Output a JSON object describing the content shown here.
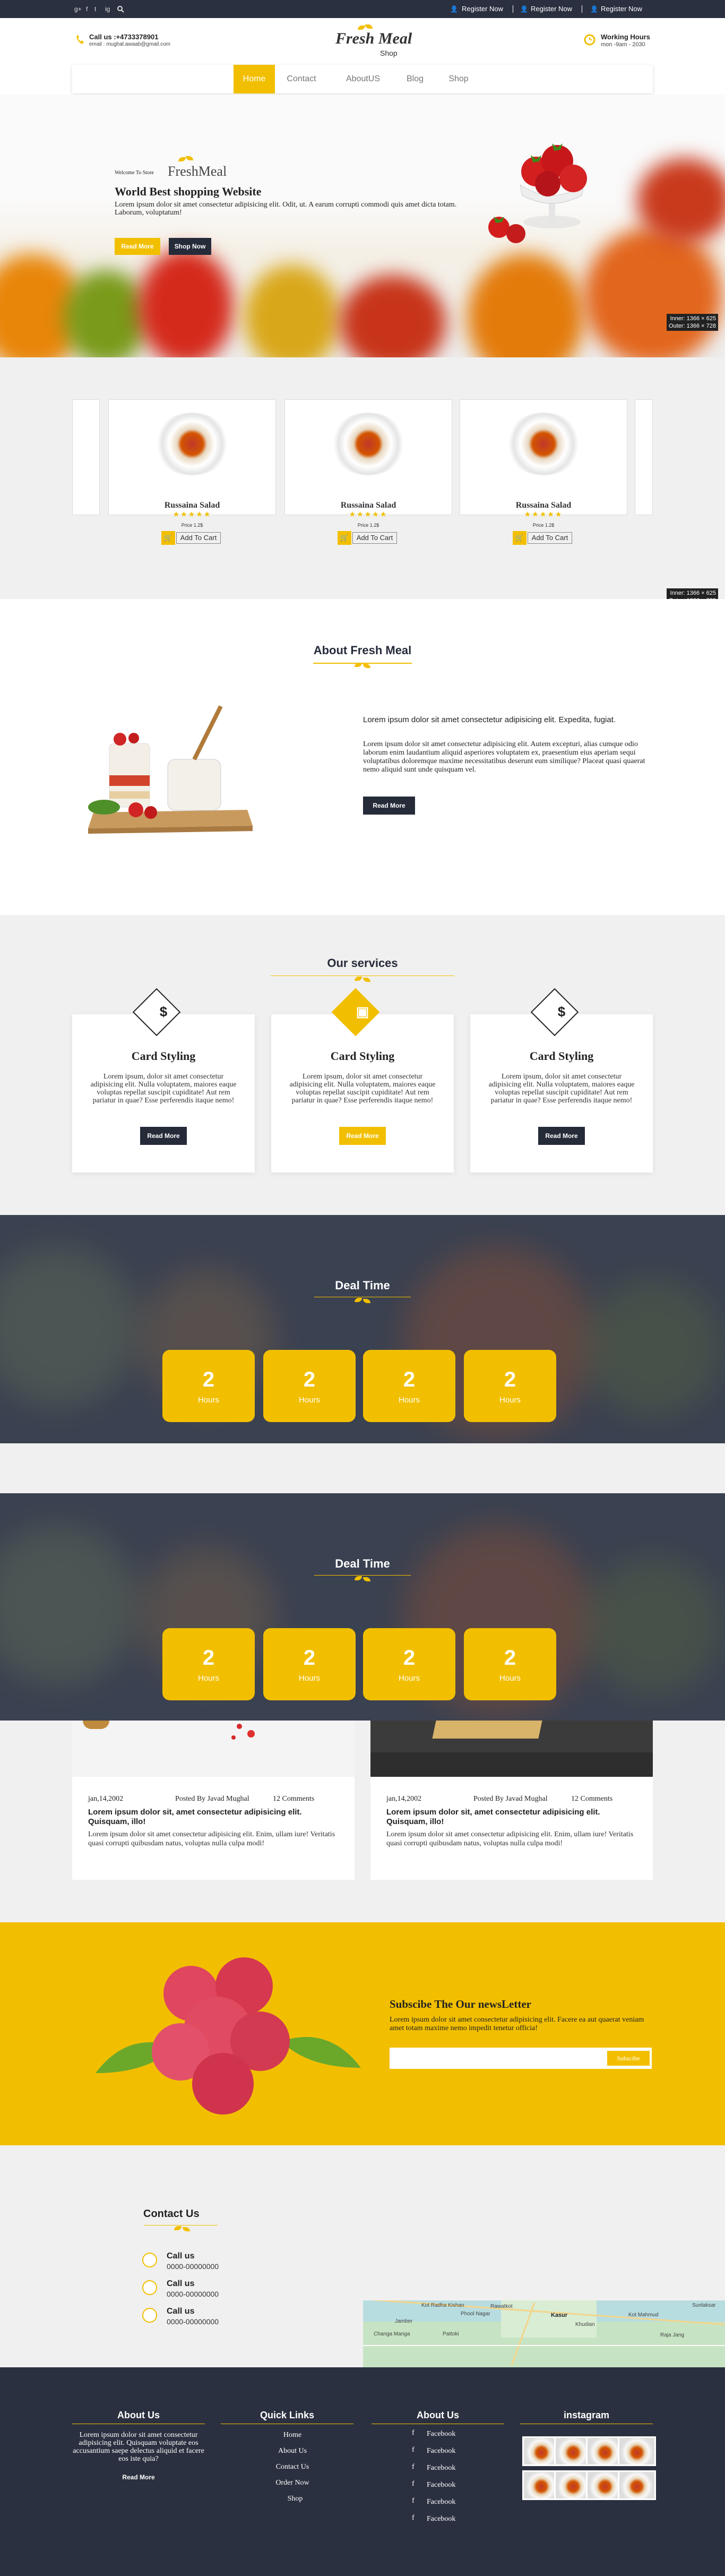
{
  "topbar": {
    "social": [
      "g+",
      "f",
      "t",
      "ig",
      "search"
    ],
    "register": [
      "Register Now",
      "Register Now",
      "Register Now"
    ]
  },
  "header": {
    "call_label": "Call us :+4733378901",
    "email": "email : mughal.awaab@gmail.com",
    "logo_script": "Fresh Meal",
    "logo_sub": "Shop",
    "hours_label": "Working Hours",
    "hours_value": "mon -9am - 2030"
  },
  "nav": {
    "items": [
      "Home",
      "Contact",
      "AboutUS",
      "Blog",
      "Shop"
    ],
    "active": "Home"
  },
  "hero": {
    "welcome": "Welcome To Store",
    "brand": "FreshMeal",
    "title": "World Best shopping Website",
    "text": "Lorem ipsum dolor sit amet consectetur adipisicing elit. Odit, ut. A earum corrupti commodi quis amet dicta totam. Laborum, voluptatum!",
    "btn_primary": "Read More",
    "btn_secondary": "Shop Now"
  },
  "badges": {
    "first_inner": "Inner: 1366 × 625",
    "first_outer": "Outer: 1366 × 728",
    "second_inner": "Inner: 1366 × 625",
    "second_outer": "Outer: 1366 × 728"
  },
  "products": [
    {
      "name": "Russaina Salad",
      "price": "Price 1.2$",
      "rating": 5,
      "cart": "Add To Cart"
    },
    {
      "name": "Russaina Salad",
      "price": "Price 1.2$",
      "rating": 5,
      "cart": "Add To Cart"
    },
    {
      "name": "Russaina Salad",
      "price": "Price 1.2$",
      "rating": 5,
      "cart": "Add To Cart"
    }
  ],
  "about": {
    "title": "About Fresh Meal",
    "lead": "Lorem ipsum dolor sit amet consectetur adipisicing elit. Expedita, fugiat.",
    "text": "Lorem ipsum dolor sit amet consectetur adipisicing elit. Autem excepturi, alias cumque odio laborum enim laudantium aliquid asperiores voluptatem ex, praesentium eius aperiam sequi voluptatibus doloremque maxime necessitatibus deserunt eum similique? Placeat quasi quaerat nemo aliquid sunt unde quisquam vel.",
    "btn": "Read More"
  },
  "services": {
    "title": "Our services",
    "cards": [
      {
        "icon": "dollar-icon",
        "symbol": "$",
        "title": "Card Styling",
        "text": "Lorem ipsum, dolor sit amet consectetur adipisicing elit. Nulla voluptatem, maiores eaque voluptas repellat suscipit cupiditate! Aut rem pariatur in quae? Esse perferendis itaque nemo!",
        "btn": "Read More"
      },
      {
        "icon": "briefcase-icon",
        "symbol": "▣",
        "title": "Card Styling",
        "text": "Lorem ipsum, dolor sit amet consectetur adipisicing elit. Nulla voluptatem, maiores eaque voluptas repellat suscipit cupiditate! Aut rem pariatur in quae? Esse perferendis itaque nemo!",
        "btn": "Read More"
      },
      {
        "icon": "dollar-icon",
        "symbol": "$",
        "title": "Card Styling",
        "text": "Lorem ipsum, dolor sit amet consectetur adipisicing elit. Nulla voluptatem, maiores eaque voluptas repellat suscipit cupiditate! Aut rem pariatur in quae? Esse perferendis itaque nemo!",
        "btn": "Read More"
      }
    ]
  },
  "deal": {
    "title": "Deal Time",
    "boxes": [
      {
        "value": "2",
        "unit": "Hours"
      },
      {
        "value": "2",
        "unit": "Hours"
      },
      {
        "value": "2",
        "unit": "Hours"
      },
      {
        "value": "2",
        "unit": "Hours"
      }
    ]
  },
  "blog": {
    "posts": [
      {
        "date": "jan,14,2002",
        "author": "Posted By Javad Mughal",
        "comments": "12 Comments",
        "title": "Lorem ipsum dolor sit, amet consectetur adipisicing elit. Quisquam, illo!",
        "text": "Lorem ipsum dolor sit amet consectetur adipisicing elit. Enim, ullam iure! Veritatis quasi corrupti quibusdam natus, voluptas nulla culpa modi!"
      },
      {
        "date": "jan,14,2002",
        "author": "Posted By Javad Mughal",
        "comments": "12 Comments",
        "title": "Lorem ipsum dolor sit, amet consectetur adipisicing elit. Quisquam, illo!",
        "text": "Lorem ipsum dolor sit amet consectetur adipisicing elit. Enim, ullam iure! Veritatis quasi corrupti quibusdam natus, voluptas nulla culpa modi!"
      }
    ]
  },
  "subscribe": {
    "title": "Subscibe The Our newsLetter",
    "text": "Lorem ipsum dolor sit amet consectetur adipisicing elit. Facere ea aut quaerat veniam amet totam maxime nemo impedit tenetur officia!",
    "placeholder": "",
    "btn": "Subscibe"
  },
  "contact": {
    "title": "Contact Us",
    "items": [
      {
        "label": "Call us",
        "value": "0000-00000000"
      },
      {
        "label": "Call us",
        "value": "0000-00000000"
      },
      {
        "label": "Call us",
        "value": "0000-00000000"
      }
    ],
    "map_labels": [
      "Rawatkot",
      "Phool Nagar",
      "Kasur",
      "Sunlaksar",
      "Jamber",
      "Khudian",
      "Kot Radha Kishan",
      "Kot Mahmud",
      "Pattoki",
      "Raja Jang",
      "Changa Manga"
    ]
  },
  "footer": {
    "about": {
      "title": "About Us",
      "text": "Lorem ipsum dolor sit amet consectetur adipisicing elit. Quisquam voluptate eos accusantium saepe delectus aliquid et facere eos iste quia?",
      "btn": "Read More"
    },
    "quick": {
      "title": "Quick Links",
      "links": [
        "Home",
        "About Us",
        "Contact Us",
        "Order Now",
        "Shop"
      ]
    },
    "about2": {
      "title": "About Us",
      "links": [
        "Facebook",
        "Facebook",
        "Facebook",
        "Facebook",
        "Facebook",
        "Facebook"
      ]
    },
    "instagram": {
      "title": "instagram",
      "count": 8
    }
  }
}
